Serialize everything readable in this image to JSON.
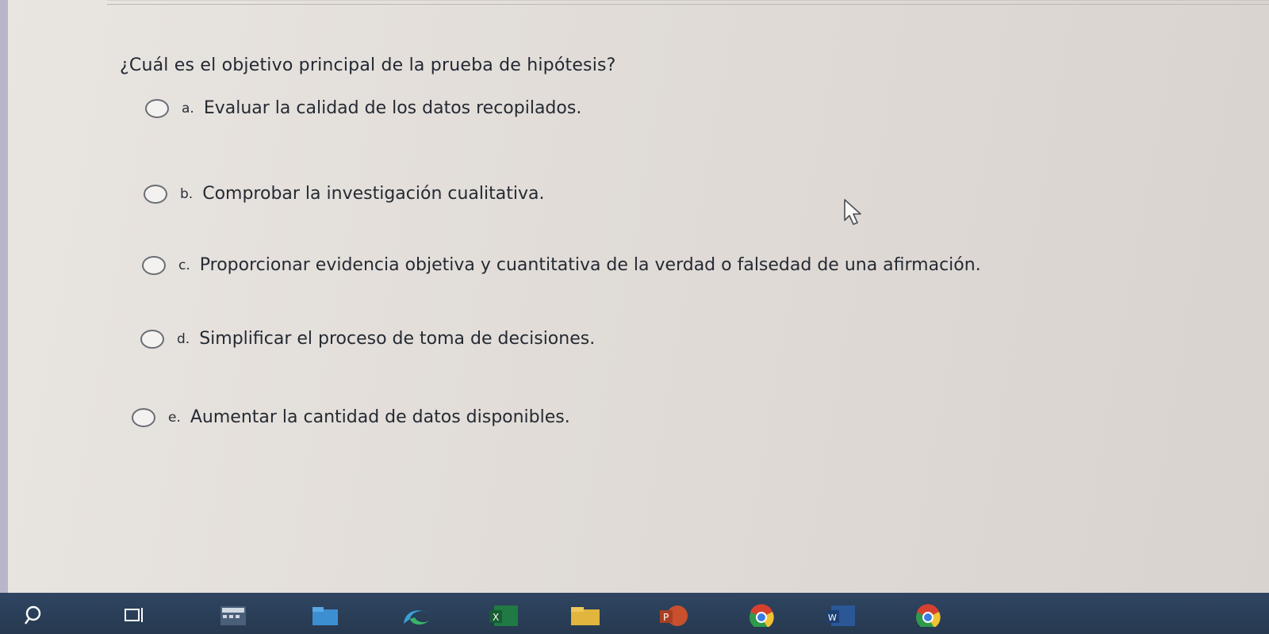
{
  "quiz": {
    "question": "¿Cuál es el objetivo principal de la prueba de hipótesis?",
    "options": [
      {
        "letter": "a.",
        "text": "Evaluar la calidad de los datos recopilados."
      },
      {
        "letter": "b.",
        "text": "Comprobar la investigación cualitativa."
      },
      {
        "letter": "c.",
        "text": "Proporcionar evidencia objetiva y cuantitativa de la verdad o falsedad de una afirmación."
      },
      {
        "letter": "d.",
        "text": "Simplificar el proceso de toma de decisiones."
      },
      {
        "letter": "e.",
        "text": "Aumentar la cantidad de datos disponibles."
      }
    ]
  },
  "taskbar": {
    "icons": [
      "search-icon",
      "task-view-icon",
      "calculator-icon",
      "file-explorer-icon",
      "edge-icon",
      "excel-icon",
      "folder-icon",
      "powerpoint-icon",
      "chrome-icon",
      "word-icon",
      "chrome-icon"
    ],
    "colors": {
      "bar": "#2b3f59",
      "excel": "#1f7a43",
      "powerpoint": "#c8502c",
      "word": "#2b5797",
      "folder": "#e2b53c",
      "chrome_red": "#d6412f",
      "chrome_green": "#2f9a4a",
      "chrome_yellow": "#f1c232"
    }
  }
}
